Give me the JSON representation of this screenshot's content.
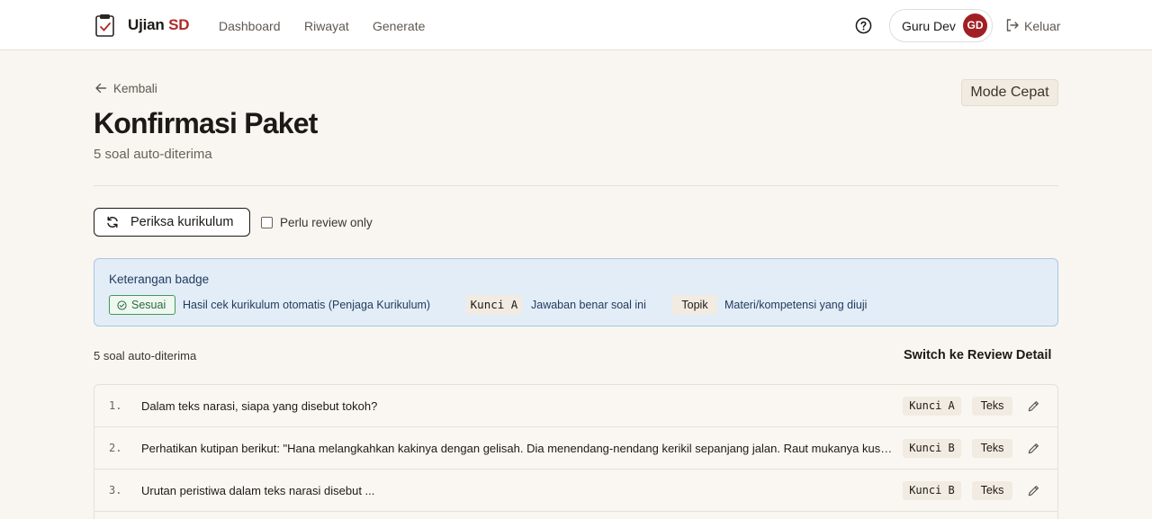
{
  "nav": {
    "brand_main": "Ujian",
    "brand_accent": "SD",
    "links": [
      "Dashboard",
      "Riwayat",
      "Generate"
    ],
    "user_name": "Guru Dev",
    "avatar_initials": "GD",
    "logout_label": "Keluar"
  },
  "header": {
    "back_label": "Kembali",
    "title": "Konfirmasi Paket",
    "subtitle": "5 soal auto-diterima",
    "mode_button": "Mode Cepat"
  },
  "toolbar": {
    "check_button": "Periksa kurikulum",
    "review_only_label": "Perlu review only",
    "review_only_checked": false
  },
  "legend": {
    "title": "Keterangan badge",
    "items": [
      {
        "badge": "Sesuai",
        "description": "Hasil cek kurikulum otomatis (Penjaga Kurikulum)"
      },
      {
        "badge": "Kunci A",
        "description": "Jawaban benar soal ini"
      },
      {
        "badge": "Topik",
        "description": "Materi/kompetensi yang diuji"
      }
    ]
  },
  "list": {
    "count_label": "5 soal auto-diterima",
    "switch_label": "Switch ke Review Detail",
    "rows": [
      {
        "number": "1.",
        "question": "Dalam teks narasi, siapa yang disebut tokoh?",
        "key": "Kunci A",
        "topic": "Teks"
      },
      {
        "number": "2.",
        "question": "Perhatikan kutipan berikut: \"Hana melangkahkan kakinya dengan gelisah. Dia menendang-nendang kerikil sepanjang jalan. Raut mukanya kusut.\"",
        "key": "Kunci B",
        "topic": "Teks"
      },
      {
        "number": "3.",
        "question": "Urutan peristiwa dalam teks narasi disebut ...",
        "key": "Kunci B",
        "topic": "Teks"
      }
    ]
  },
  "colors": {
    "accent_red": "#b02a2a",
    "legend_bg": "#e3edf7",
    "badge_green": "#3f9a58"
  },
  "icons": [
    "clipboard-logo-icon",
    "help-circle-icon",
    "logout-icon",
    "arrow-left-icon",
    "refresh-icon",
    "check-circle-icon",
    "pencil-icon"
  ]
}
